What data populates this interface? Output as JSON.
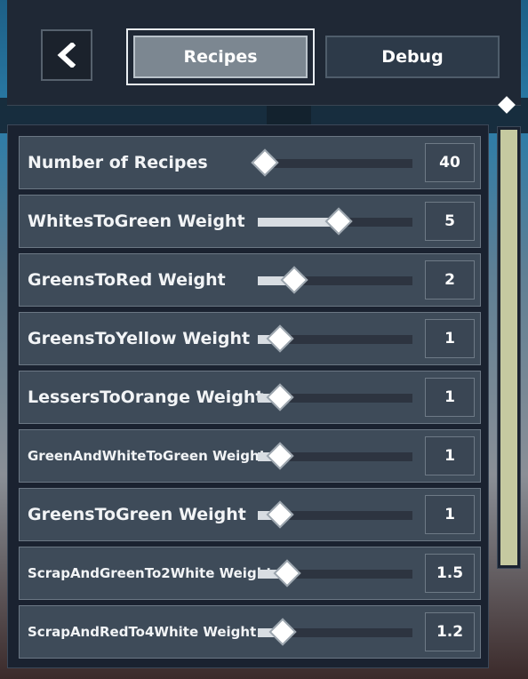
{
  "header": {
    "back_icon": "chevron-left-icon",
    "tabs": [
      {
        "label": "Recipes",
        "active": true
      },
      {
        "label": "Debug",
        "active": false
      }
    ]
  },
  "settings": [
    {
      "label": "Number of Recipes",
      "value": "40",
      "fraction": 0.0,
      "font_size": 19
    },
    {
      "label": "WhitesToGreen Weight",
      "value": "5",
      "fraction": 0.5,
      "font_size": 19
    },
    {
      "label": "GreensToRed Weight",
      "value": "2",
      "fraction": 0.2,
      "font_size": 19
    },
    {
      "label": "GreensToYellow Weight",
      "value": "1",
      "fraction": 0.1,
      "font_size": 19
    },
    {
      "label": "LessersToOrange Weight",
      "value": "1",
      "fraction": 0.1,
      "font_size": 19
    },
    {
      "label": "GreenAndWhiteToGreen Weight",
      "value": "1",
      "fraction": 0.1,
      "font_size": 15
    },
    {
      "label": "GreensToGreen Weight",
      "value": "1",
      "fraction": 0.1,
      "font_size": 19
    },
    {
      "label": "ScrapAndGreenTo2White Weight",
      "value": "1.5",
      "fraction": 0.15,
      "font_size": 15
    },
    {
      "label": "ScrapAndRedTo4White Weight",
      "value": "1.2",
      "fraction": 0.12,
      "font_size": 15
    }
  ],
  "scrollbar": {
    "position": 0.0
  }
}
